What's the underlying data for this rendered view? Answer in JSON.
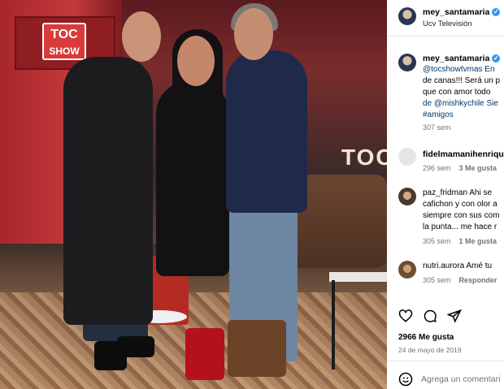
{
  "post": {
    "author": "mey_santamaria",
    "location": "Ucv Televisión",
    "image_logo_text": [
      "TOC",
      "SHOW"
    ],
    "image_neon_text": "TOC"
  },
  "caption": {
    "author": "mey_santamaria",
    "lines": [
      "@tocshowtvmas En",
      "de canas!!! Será un p",
      "que con amor todo",
      "de @mishkychile Sie",
      "#amigos"
    ],
    "time": "307 sem"
  },
  "comments": [
    {
      "user": "fidelmamanihenriqu",
      "lines": [],
      "time": "296 sem",
      "likes": "3 Me gusta"
    },
    {
      "user": "paz_fridman",
      "lines": [
        "paz_fridman Ahi se",
        "cafichon y con olor a",
        "siempre con sus com",
        "la punta... me hace r"
      ],
      "time": "305 sem",
      "likes": "1 Me gusta"
    },
    {
      "user": "nutri.aurora",
      "lines": [
        "nutri.aurora Amé tu"
      ],
      "time": "305 sem",
      "reply": "Responder"
    }
  ],
  "likes_count": "2966 Me gusta",
  "date": "24 de mayo de 2019",
  "add_comment_placeholder": "Agrega un comentari"
}
